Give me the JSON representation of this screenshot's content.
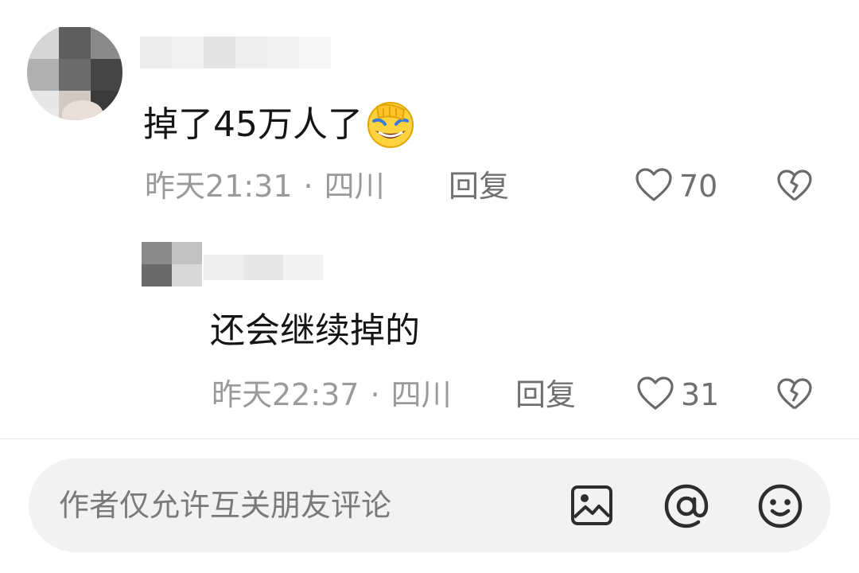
{
  "comments": [
    {
      "text": "掉了45万人了",
      "emoji": "facepalm-laughing-emoji",
      "time": "昨天21:31",
      "separator": "·",
      "location": "四川",
      "reply_label": "回复",
      "likes": "70"
    },
    {
      "text": "还会继续掉的",
      "time": "昨天22:37",
      "separator": "·",
      "location": "四川",
      "reply_label": "回复",
      "likes": "31"
    }
  ],
  "input_bar": {
    "placeholder": "作者仅允许互关朋友评论",
    "icons": [
      "image-icon",
      "at-mention-icon",
      "emoji-smile-icon"
    ]
  },
  "icons": {
    "like": "heart-outline-icon",
    "dislike": "broken-heart-icon"
  }
}
